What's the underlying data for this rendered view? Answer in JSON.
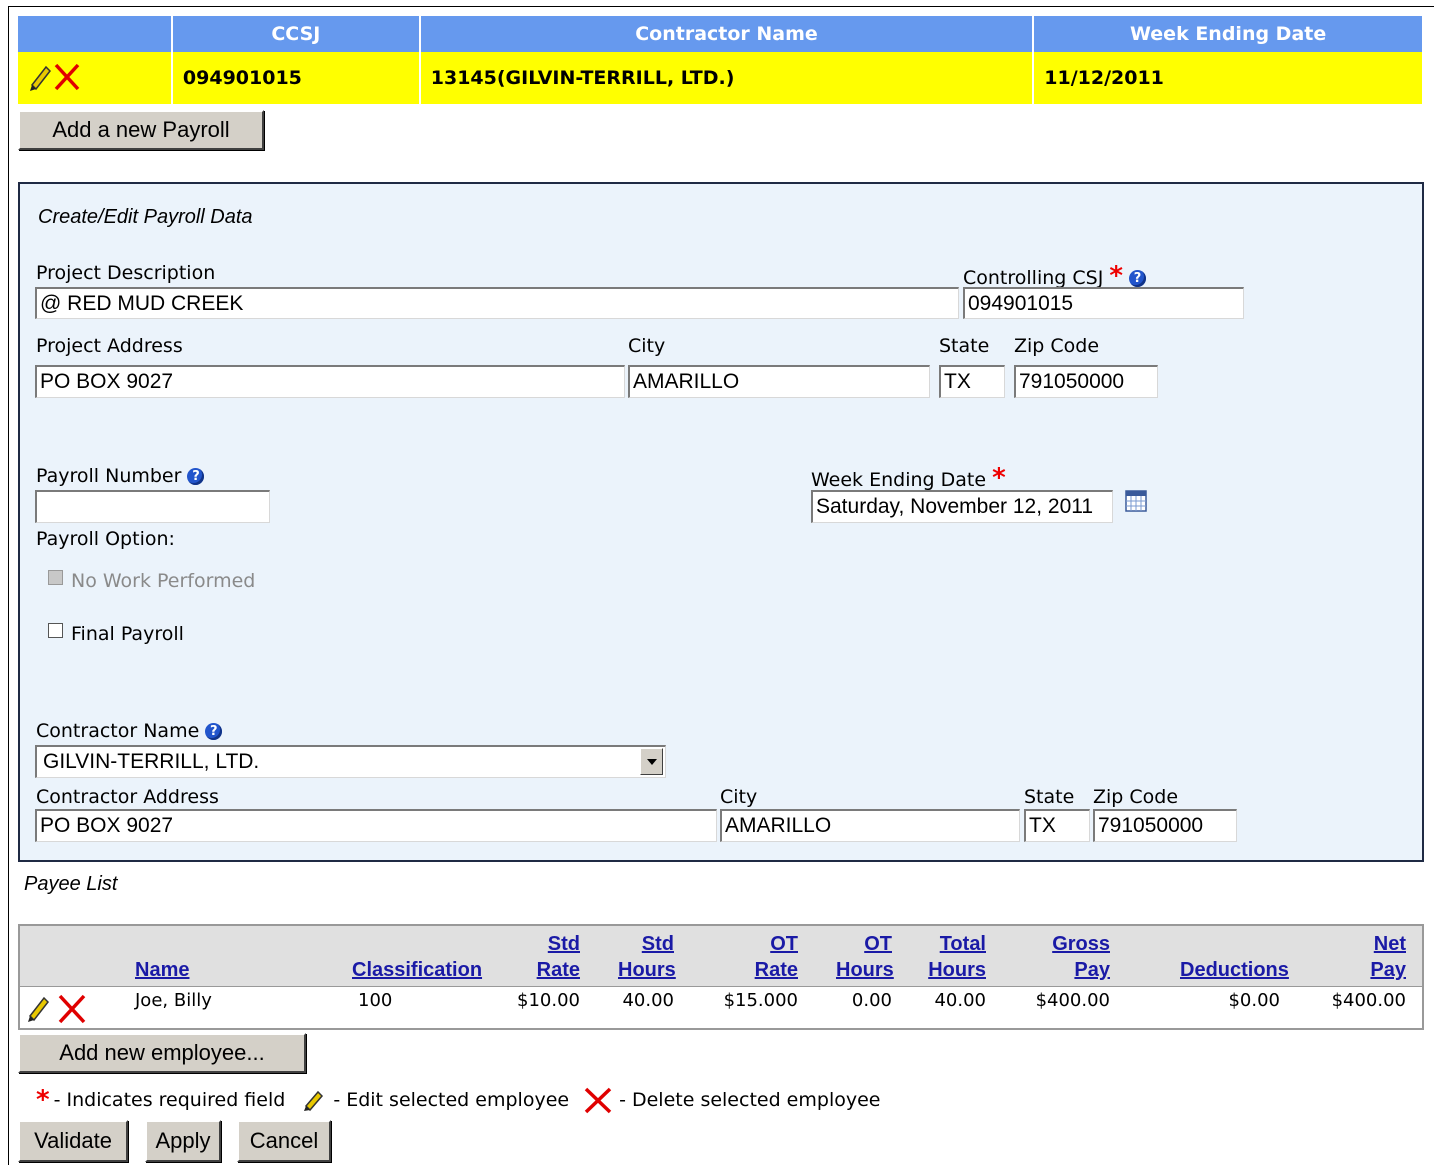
{
  "payroll_table": {
    "headers": {
      "ccsj": "CCSJ",
      "contractor": "Contractor Name",
      "week": "Week Ending Date"
    },
    "row": {
      "ccsj": "094901015",
      "contractor": "13145(GILVIN-TERRILL, LTD.)",
      "week": "11/12/2011"
    }
  },
  "add_payroll_label": "Add a new Payroll",
  "form": {
    "title": "Create/Edit Payroll Data",
    "project_description_label": "Project Description",
    "project_description": "@ RED MUD CREEK",
    "controlling_csj_label": "Controlling CSJ",
    "controlling_csj": "094901015",
    "project_address_label": "Project Address",
    "project_address": "PO BOX 9027",
    "city_label": "City",
    "city": "AMARILLO",
    "state_label": "State",
    "state": "TX",
    "zip_label": "Zip Code",
    "zip": "791050000",
    "payroll_number_label": "Payroll Number",
    "payroll_number": "",
    "week_ending_label": "Week Ending Date",
    "week_ending": "Saturday, November 12, 2011",
    "payroll_option_label": "Payroll Option:",
    "no_work_label": "No Work Performed",
    "final_payroll_label": "Final Payroll",
    "contractor_name_label": "Contractor Name",
    "contractor_name": "GILVIN-TERRILL, LTD.",
    "contractor_address_label": "Contractor Address",
    "contractor_address": "PO BOX 9027",
    "contractor_city_label": "City",
    "contractor_city": "AMARILLO",
    "contractor_state_label": "State",
    "contractor_state": "TX",
    "contractor_zip_label": "Zip Code",
    "contractor_zip": "791050000"
  },
  "payee": {
    "title": "Payee List",
    "headers": {
      "name": "Name",
      "classification": "Classification",
      "std_rate_1": "Std",
      "std_rate_2": "Rate",
      "std_hours_1": "Std",
      "std_hours_2": "Hours",
      "ot_rate_1": "OT",
      "ot_rate_2": "Rate",
      "ot_hours_1": "OT",
      "ot_hours_2": "Hours",
      "total_hours_1": "Total",
      "total_hours_2": "Hours",
      "gross_1": "Gross",
      "gross_2": "Pay",
      "deductions": "Deductions",
      "net_1": "Net",
      "net_2": "Pay"
    },
    "row": {
      "name": "Joe, Billy",
      "classification": "100",
      "std_rate": "$10.00",
      "std_hours": "40.00",
      "ot_rate": "$15.000",
      "ot_hours": "0.00",
      "total_hours": "40.00",
      "gross": "$400.00",
      "deductions": "$0.00",
      "net": "$400.00"
    }
  },
  "add_employee_label": "Add new employee...",
  "legend": {
    "required": "- Indicates required field",
    "edit": "- Edit selected employee",
    "delete": "- Delete selected employee"
  },
  "buttons": {
    "validate": "Validate",
    "apply": "Apply",
    "cancel": "Cancel"
  },
  "colors": {
    "header_blue": "#6699ee",
    "row_yellow": "#ffff00",
    "panel_bg": "#ebf3fb",
    "link_blue": "#1a1aa6",
    "required_red": "#ee0000"
  }
}
